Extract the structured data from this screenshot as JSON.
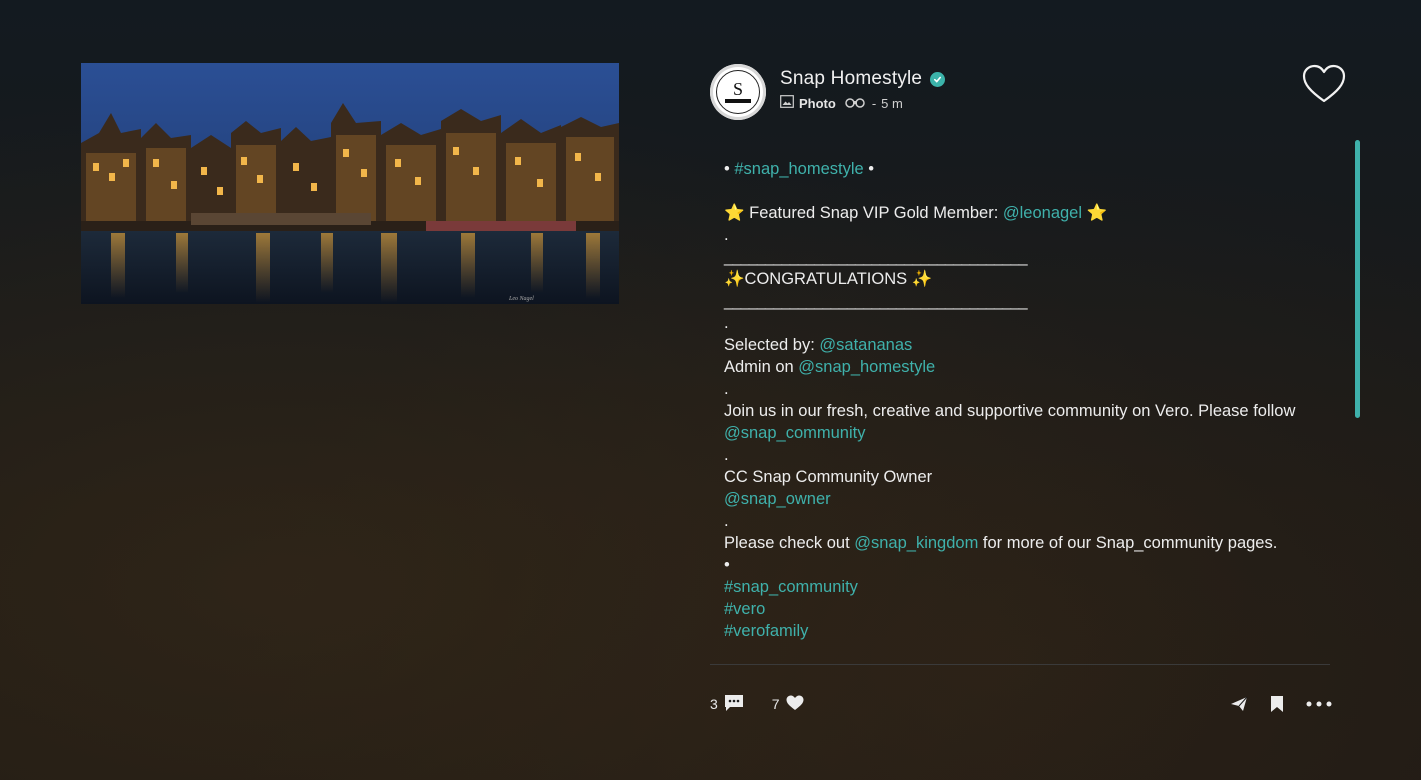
{
  "photo": {
    "alt": "Amsterdam canal houses at night",
    "watermark": "Leo Nagel"
  },
  "post": {
    "author": "Snap Homestyle",
    "avatar_letter": "S",
    "type_label": "Photo",
    "time_sep": "-",
    "time": "5 m",
    "icons": {
      "verified": "verified-check-icon",
      "photo": "photo-icon",
      "views": "binoculars-icon",
      "like": "heart-outline-icon"
    },
    "accent_color": "#3fb1ab"
  },
  "caption": {
    "l1_pre": "• ",
    "l1_tag": "#snap_homestyle",
    "l1_post": " •",
    "l2_pre": "⭐ Featured Snap VIP Gold Member: ",
    "l2_link": "@leonagel",
    "l2_post": " ⭐",
    "dot1": ".",
    "rule1": "_____________________________________",
    "congrats": "✨CONGRATULATIONS ✨",
    "rule2": "_____________________________________",
    "dot2": ".",
    "selected_pre": "Selected by: ",
    "selected_link": "@satananas",
    "admin_pre": "Admin on ",
    "admin_link": "@snap_homestyle",
    "dot3": ".",
    "join_text": "Join us in our fresh, creative and supportive community on Vero. Please follow ",
    "join_link": "@snap_community",
    "dot4": ".",
    "cc_text": "CC Snap Community Owner",
    "owner_link": "@snap_owner",
    "dot5": ".",
    "check_pre": "Please check out ",
    "check_link": "@snap_kingdom",
    "check_post": " for more of our Snap_community pages.",
    "bullet": "•",
    "tag1": "#snap_community",
    "tag2": "#vero",
    "tag3": "#verofamily"
  },
  "actions": {
    "comments_count": "3",
    "likes_count": "7",
    "icons": [
      "comment-icon",
      "heart-icon",
      "send-icon",
      "bookmark-icon",
      "more-icon"
    ]
  }
}
